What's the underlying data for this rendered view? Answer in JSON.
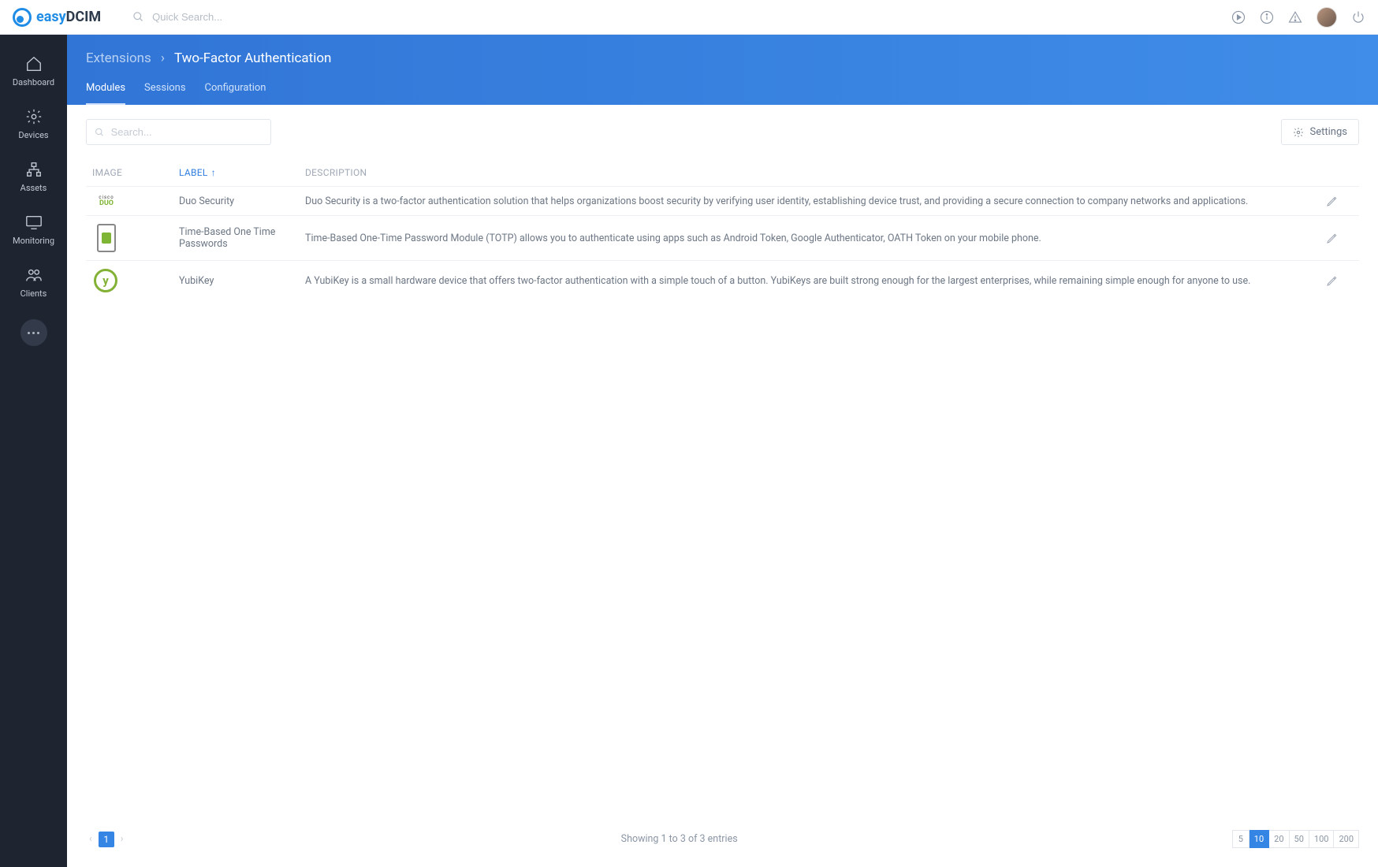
{
  "brand": {
    "name_left": "easy",
    "name_right": "DCIM"
  },
  "topbar": {
    "search_placeholder": "Quick Search..."
  },
  "sidebar": {
    "items": [
      {
        "label": "Dashboard"
      },
      {
        "label": "Devices"
      },
      {
        "label": "Assets"
      },
      {
        "label": "Monitoring"
      },
      {
        "label": "Clients"
      }
    ]
  },
  "breadcrumb": {
    "parent": "Extensions",
    "current": "Two-Factor Authentication"
  },
  "tabs": {
    "items": [
      "Modules",
      "Sessions",
      "Configuration"
    ],
    "active": 0
  },
  "toolbar": {
    "search_placeholder": "Search...",
    "settings_label": "Settings"
  },
  "table": {
    "headers": {
      "image": "IMAGE",
      "label": "LABEL",
      "description": "DESCRIPTION"
    },
    "rows": [
      {
        "icon": "duo",
        "label": "Duo Security",
        "description": "Duo Security is a two-factor authentication solution that helps organizations boost security by verifying user identity, establishing device trust, and providing a secure connection to company networks and applications."
      },
      {
        "icon": "phone",
        "label": "Time-Based One Time Passwords",
        "description": "Time-Based One-Time Password Module (TOTP) allows you to authenticate using apps such as Android Token, Google Authenticator, OATH Token on your mobile phone."
      },
      {
        "icon": "yubi",
        "label": "YubiKey",
        "description": "A YubiKey is a small hardware device that offers two-factor authentication with a simple touch of a button. YubiKeys are built strong enough for the largest enterprises, while remaining simple enough for anyone to use."
      }
    ]
  },
  "footer": {
    "current_page": "1",
    "entries_text": "Showing 1 to 3 of 3 entries",
    "page_sizes": [
      "5",
      "10",
      "20",
      "50",
      "100",
      "200"
    ],
    "active_size": "10"
  }
}
